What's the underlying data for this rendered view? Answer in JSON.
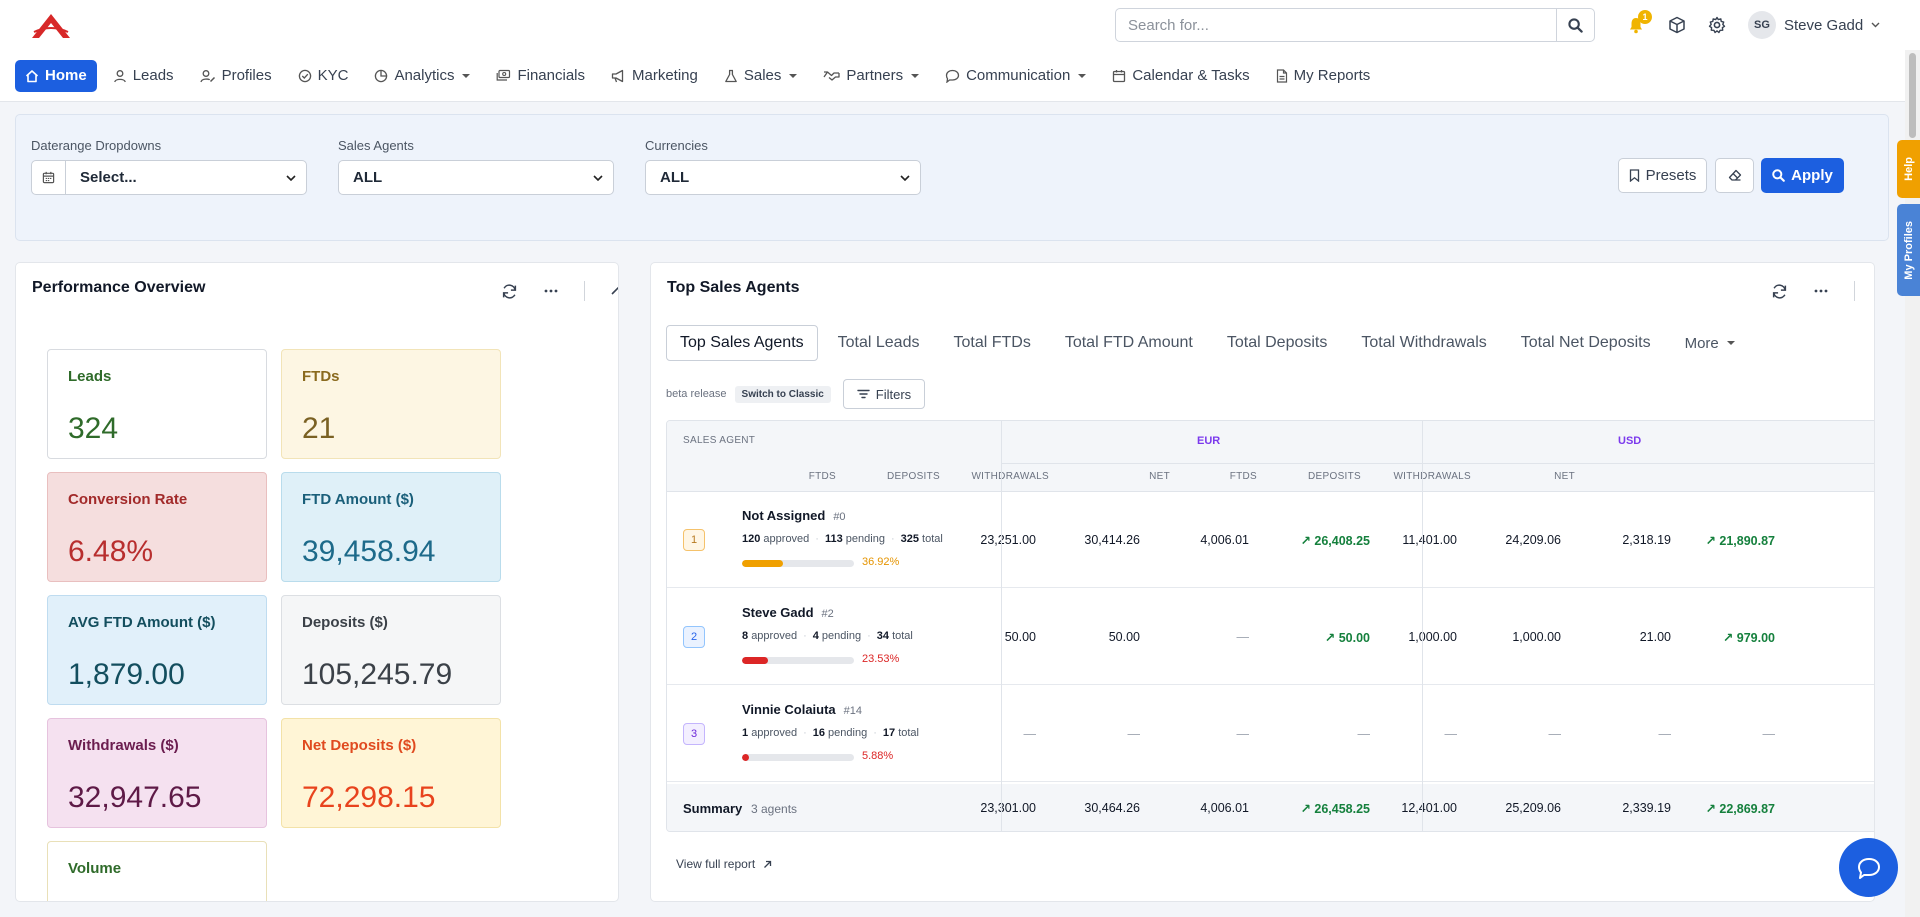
{
  "header": {
    "search_placeholder": "Search for...",
    "notification_count": "1",
    "user_initials": "SG",
    "user_name": "Steve Gadd"
  },
  "nav": [
    {
      "label": "Home",
      "icon": "home-icon",
      "active": true
    },
    {
      "label": "Leads",
      "icon": "user-icon"
    },
    {
      "label": "Profiles",
      "icon": "user-edit-icon"
    },
    {
      "label": "KYC",
      "icon": "check-circle-icon"
    },
    {
      "label": "Analytics",
      "icon": "chart-pie-icon",
      "dropdown": true
    },
    {
      "label": "Financials",
      "icon": "money-icon"
    },
    {
      "label": "Marketing",
      "icon": "megaphone-icon"
    },
    {
      "label": "Sales",
      "icon": "flask-icon",
      "dropdown": true
    },
    {
      "label": "Partners",
      "icon": "handshake-icon",
      "dropdown": true
    },
    {
      "label": "Communication",
      "icon": "chat-icon",
      "dropdown": true
    },
    {
      "label": "Calendar & Tasks",
      "icon": "calendar-icon"
    },
    {
      "label": "My Reports",
      "icon": "file-icon"
    }
  ],
  "filters": {
    "daterange_label": "Daterange Dropdowns",
    "daterange_value": "Select...",
    "agents_label": "Sales Agents",
    "agents_value": "ALL",
    "currencies_label": "Currencies",
    "currencies_value": "ALL",
    "presets_label": "Presets",
    "apply_label": "Apply"
  },
  "performance": {
    "title": "Performance Overview",
    "cards": [
      {
        "label": "Leads",
        "value": "324"
      },
      {
        "label": "FTDs",
        "value": "21"
      },
      {
        "label": "Conversion Rate",
        "value": "6.48%"
      },
      {
        "label": "FTD Amount ($)",
        "value": "39,458.94"
      },
      {
        "label": "AVG FTD Amount ($)",
        "value": "1,879.00"
      },
      {
        "label": "Deposits ($)",
        "value": "105,245.79"
      },
      {
        "label": "Withdrawals ($)",
        "value": "32,947.65"
      },
      {
        "label": "Net Deposits ($)",
        "value": "72,298.15"
      },
      {
        "label": "Volume",
        "value": ""
      }
    ]
  },
  "top_agents": {
    "title": "Top Sales Agents",
    "tabs": [
      "Top Sales Agents",
      "Total Leads",
      "Total FTDs",
      "Total FTD Amount",
      "Total Deposits",
      "Total Withdrawals",
      "Total Net Deposits",
      "More"
    ],
    "beta_text": "beta release",
    "switch_label": "Switch to Classic",
    "filters_label": "Filters",
    "headers": {
      "agent": "SALES AGENT",
      "eur": "EUR",
      "usd": "USD",
      "ftds": "FTDS",
      "deposits": "DEPOSITS",
      "withdrawals": "WITHDRAWALS",
      "net": "NET"
    },
    "rows": [
      {
        "rank": "1",
        "name": "Not Assigned",
        "id": "#0",
        "approved": "120",
        "pending": "113",
        "total": "325",
        "pct": "36.92%",
        "progress": 0.3692,
        "eur": [
          "23,251.00",
          "30,414.26",
          "4,006.01",
          "↗ 26,408.25"
        ],
        "usd": [
          "11,401.00",
          "24,209.06",
          "2,318.19",
          "↗ 21,890.87"
        ]
      },
      {
        "rank": "2",
        "name": "Steve Gadd",
        "id": "#2",
        "approved": "8",
        "pending": "4",
        "total": "34",
        "pct": "23.53%",
        "progress": 0.2353,
        "eur": [
          "50.00",
          "50.00",
          "—",
          "↗ 50.00"
        ],
        "usd": [
          "1,000.00",
          "1,000.00",
          "21.00",
          "↗ 979.00"
        ]
      },
      {
        "rank": "3",
        "name": "Vinnie Colaiuta",
        "id": "#14",
        "approved": "1",
        "pending": "16",
        "total": "17",
        "pct": "5.88%",
        "progress": 0.0588,
        "eur": [
          "—",
          "—",
          "—",
          "—"
        ],
        "usd": [
          "—",
          "—",
          "—",
          "—"
        ]
      }
    ],
    "labels": {
      "approved": "approved",
      "pending": "pending",
      "total": "total"
    },
    "summary": {
      "label": "Summary",
      "count": "3 agents",
      "eur": [
        "23,301.00",
        "30,464.26",
        "4,006.01",
        "↗ 26,458.25"
      ],
      "usd": [
        "12,401.00",
        "25,209.06",
        "2,339.19",
        "↗ 22,869.87"
      ]
    },
    "view_full": "View full report"
  },
  "side_tabs": {
    "help": "Help",
    "profiles": "My Profiles"
  },
  "colors": {
    "primary": "#1c5fe0",
    "positive": "#15803d",
    "warning": "#f0a000",
    "danger": "#dc2626"
  }
}
